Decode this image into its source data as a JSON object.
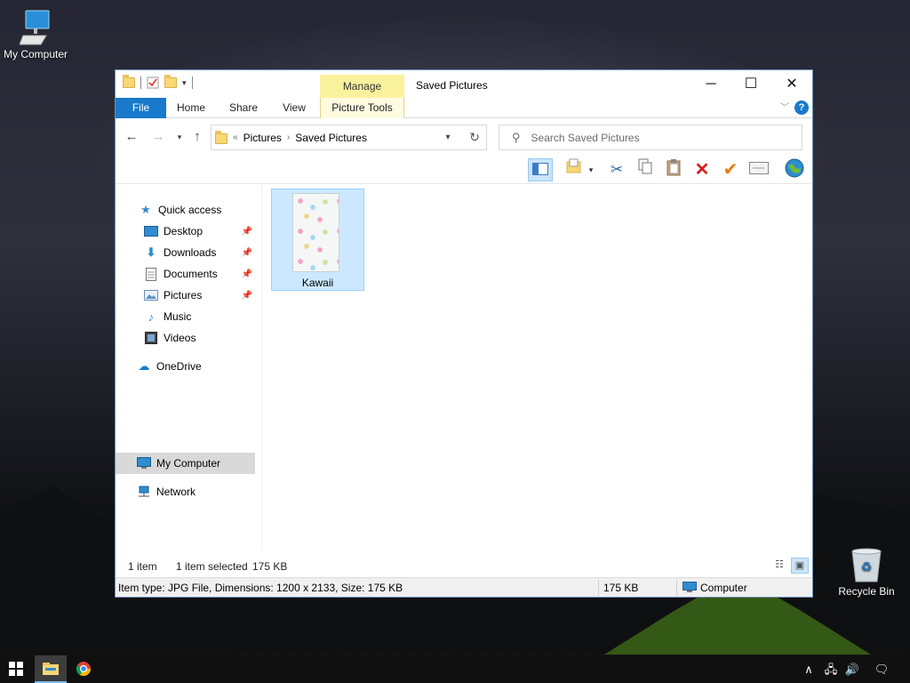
{
  "desktop": {
    "icons": [
      {
        "label": "My Computer",
        "icon": "computer-icon"
      },
      {
        "label": "Recycle Bin",
        "icon": "recycle-bin-icon"
      }
    ]
  },
  "window": {
    "title": "Saved Pictures",
    "context_tab": "Manage",
    "controls": {
      "minimize": "─",
      "maximize": "☐",
      "close": "✕"
    }
  },
  "ribbon": {
    "tabs": [
      {
        "label": "File",
        "active": true
      },
      {
        "label": "Home"
      },
      {
        "label": "Share"
      },
      {
        "label": "View"
      },
      {
        "label": "Picture Tools"
      }
    ]
  },
  "address": {
    "overflow": "«",
    "crumbs": [
      "Pictures",
      "Saved Pictures"
    ],
    "search_placeholder": "Search Saved Pictures"
  },
  "toolbar": {
    "buttons": [
      "pane-layout-icon",
      "new-folder-icon",
      "cut-icon",
      "copy-icon",
      "paste-icon",
      "delete-icon",
      "properties-check-icon",
      "rename-icon",
      "globe-icon"
    ]
  },
  "nav": {
    "items": [
      {
        "label": "Quick access",
        "icon": "star-icon",
        "pinned": false,
        "indent": false
      },
      {
        "label": "Desktop",
        "icon": "desktop-icon",
        "pinned": true,
        "indent": true
      },
      {
        "label": "Downloads",
        "icon": "downloads-icon",
        "pinned": true,
        "indent": true
      },
      {
        "label": "Documents",
        "icon": "documents-icon",
        "pinned": true,
        "indent": true
      },
      {
        "label": "Pictures",
        "icon": "pictures-icon",
        "pinned": true,
        "indent": true
      },
      {
        "label": "Music",
        "icon": "music-icon",
        "pinned": false,
        "indent": true
      },
      {
        "label": "Videos",
        "icon": "videos-icon",
        "pinned": false,
        "indent": true
      },
      {
        "label": "OneDrive",
        "icon": "cloud-icon",
        "pinned": false,
        "indent": false
      },
      {
        "label": "My Computer",
        "icon": "computer-icon",
        "pinned": false,
        "indent": false,
        "selected": true
      },
      {
        "label": "Network",
        "icon": "network-icon",
        "pinned": false,
        "indent": false
      }
    ]
  },
  "files": [
    {
      "name": "Kawaii",
      "type": "JPG File",
      "selected": true
    }
  ],
  "status": {
    "count": "1 item",
    "selected": "1 item selected",
    "size": "175 KB"
  },
  "infobar": {
    "details": "Item type: JPG File, Dimensions: 1200 x 2133, Size: 175 KB",
    "size": "175 KB",
    "location": "Computer"
  },
  "colors": {
    "accent": "#1979ca",
    "selection": "#cce8ff",
    "manage_tab": "#fbf29e"
  }
}
